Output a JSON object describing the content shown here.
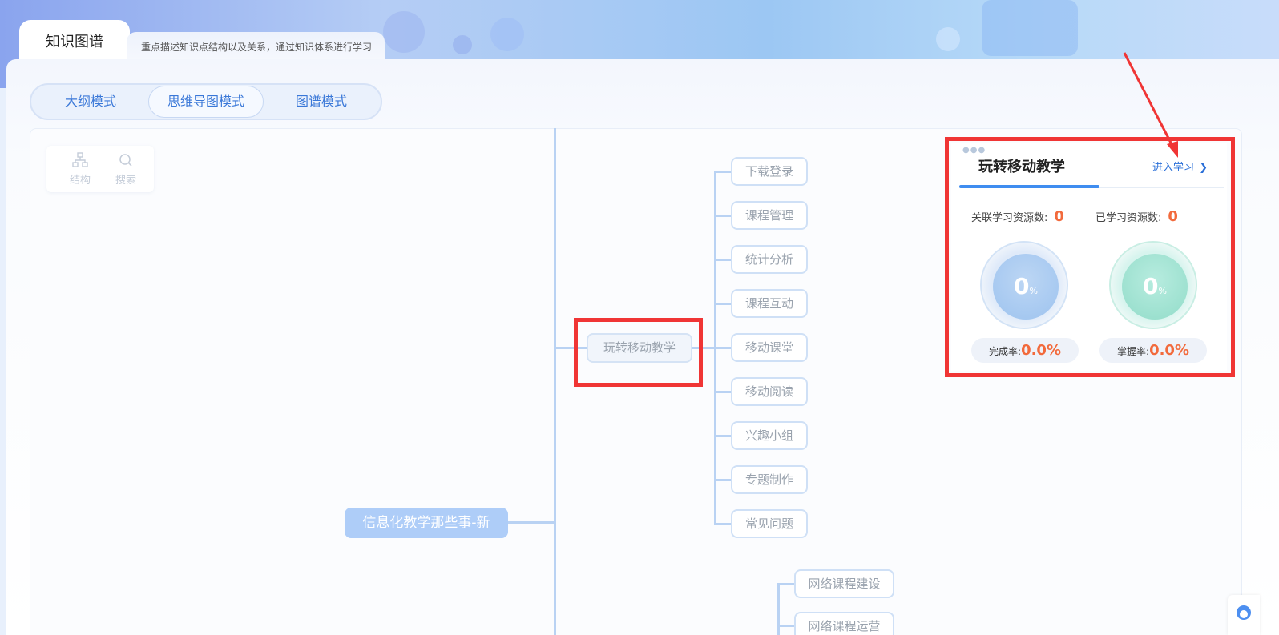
{
  "header": {
    "tab_title": "知识图谱",
    "tab_description": "重点描述知识点结构以及关系，通过知识体系进行学习"
  },
  "modes": [
    {
      "label": "大纲模式",
      "active": false
    },
    {
      "label": "思维导图模式",
      "active": true
    },
    {
      "label": "图谱模式",
      "active": false
    }
  ],
  "toolbox": {
    "structure_label": "结构",
    "structure_icon": "hierarchy-icon",
    "search_label": "搜索",
    "search_icon": "search-icon"
  },
  "mindmap": {
    "root": "信息化教学那些事-新",
    "selected_node": "玩转移动教学",
    "children": [
      "下载登录",
      "课程管理",
      "统计分析",
      "课程互动",
      "移动课堂",
      "移动阅读",
      "兴趣小组",
      "专题制作",
      "常见问题"
    ],
    "next_branch_children": [
      "网络课程建设",
      "网络课程运营"
    ]
  },
  "detail_card": {
    "title": "玩转移动教学",
    "enter_link": "进入学习",
    "related_label": "关联学习资源数:",
    "related_value": "0",
    "learned_label": "已学习资源数:",
    "learned_value": "0",
    "dial_left_value": "0",
    "dial_right_value": "0",
    "percent_sign": "%",
    "completion_label": "完成率:",
    "completion_value": "0.0%",
    "mastery_label": "掌握率:",
    "mastery_value": "0.0%"
  },
  "colors": {
    "accent": "#3a78d8",
    "highlight_border": "#f03535",
    "metric_value": "#f26a3c",
    "root_node": "#aecdf8"
  }
}
